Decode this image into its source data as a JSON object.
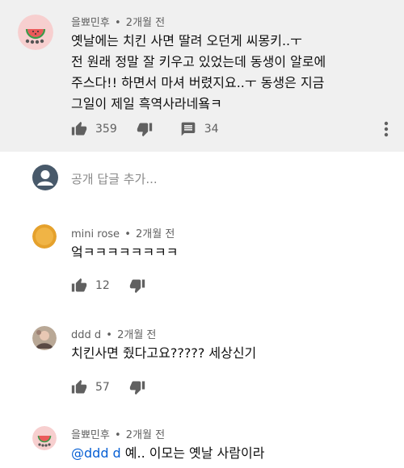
{
  "main_comment": {
    "author": "을뾰민후",
    "time": "2개월 전",
    "text": "옛날에는 치킨 사면 딸려 오던게 씨몽키..ㅜ\n전 원래 정말 잘 키우고 있었는데 동생이 알로에\n주스다!! 하면서 마셔 버렸지요..ㅜ 동생은 지금\n그일이 제일 흑역사라네욬ㅋ",
    "likes": "359",
    "replies_count": "34"
  },
  "reply_box": {
    "placeholder": "공개 답글 추가..."
  },
  "replies": [
    {
      "author": "mini rose",
      "time": "2개월 전",
      "text": "엌ㅋㅋㅋㅋㅋㅋㅋㅋ",
      "likes": "12"
    },
    {
      "author": "ddd d",
      "time": "2개월 전",
      "text": "치킨사면 줬다고요????? 세상신기",
      "likes": "57"
    },
    {
      "author": "을뾰민후",
      "time": "2개월 전",
      "mention": "@ddd d",
      "text": " 예.. 이모는 옛날 사람이라"
    }
  ],
  "colors": {
    "main_bg": "#f0f0f0",
    "meta_text": "#606060",
    "mention": "#065fd4",
    "icon": "#606060"
  },
  "icons": {
    "like": "thumbs-up-icon",
    "dislike": "thumbs-down-icon",
    "reply": "reply-comment-icon",
    "more": "more-vert-icon"
  }
}
